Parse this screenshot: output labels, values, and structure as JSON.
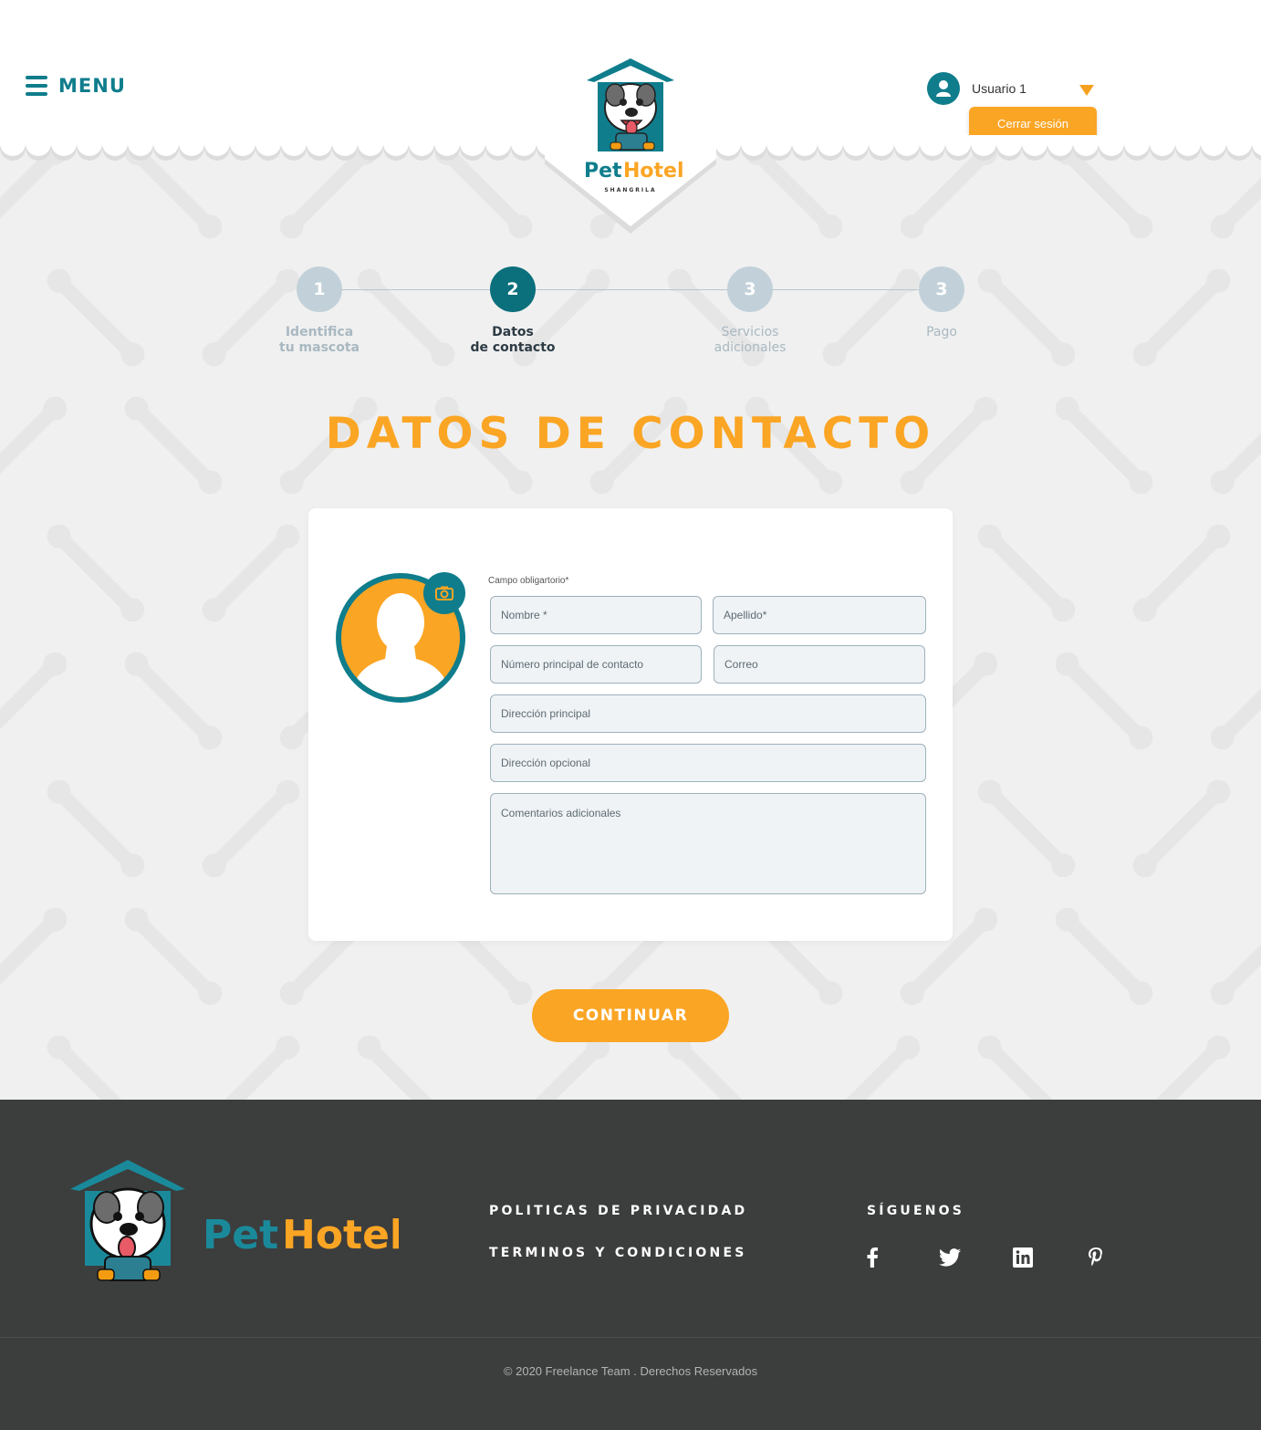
{
  "header": {
    "menu_label": "MENU",
    "user_name": "Usuario 1",
    "logout_label": "Cerrar sesión",
    "logo_text_pet": "Pet",
    "logo_text_hotel": "Hotel",
    "logo_subtitle": "SHANGRILA"
  },
  "steps": [
    {
      "number": "1",
      "line1": "Identifica",
      "line2": "tu mascota",
      "state": "done"
    },
    {
      "number": "2",
      "line1": "Datos",
      "line2": "de contacto",
      "state": "active"
    },
    {
      "number": "3",
      "line1": "Servicios",
      "line2": "adicionales",
      "state": "pending"
    },
    {
      "number": "3",
      "line1": "Pago",
      "line2": "",
      "state": "pending"
    }
  ],
  "page": {
    "title": "DATOS DE CONTACTO",
    "continue_label": "CONTINUAR"
  },
  "form": {
    "required_note": "Campo obligartorio*",
    "first_name_placeholder": "Nombre *",
    "last_name_placeholder": "Apellido*",
    "phone_placeholder": "Número principal de contacto",
    "email_placeholder": "Correo",
    "address_placeholder": "Dirección principal",
    "address_optional_placeholder": "Dirección opcional",
    "comments_placeholder": "Comentarios adicionales"
  },
  "footer": {
    "privacy_link": "POLITICAS DE PRIVACIDAD",
    "terms_link": "TERMINOS Y CONDICIONES",
    "follow_label": "SÍGUENOS",
    "logo_text_pet": "Pet",
    "logo_text_hotel": "Hotel",
    "copyright": "© 2020 Freelance Team . Derechos Reservados",
    "social_icons": [
      "facebook-icon",
      "twitter-icon",
      "linkedin-icon",
      "pinterest-icon"
    ]
  },
  "colors": {
    "teal": "#0f7d8c",
    "orange": "#fba524",
    "footer_bg": "#3c3d3d",
    "page_bg": "#f0f0f0"
  }
}
